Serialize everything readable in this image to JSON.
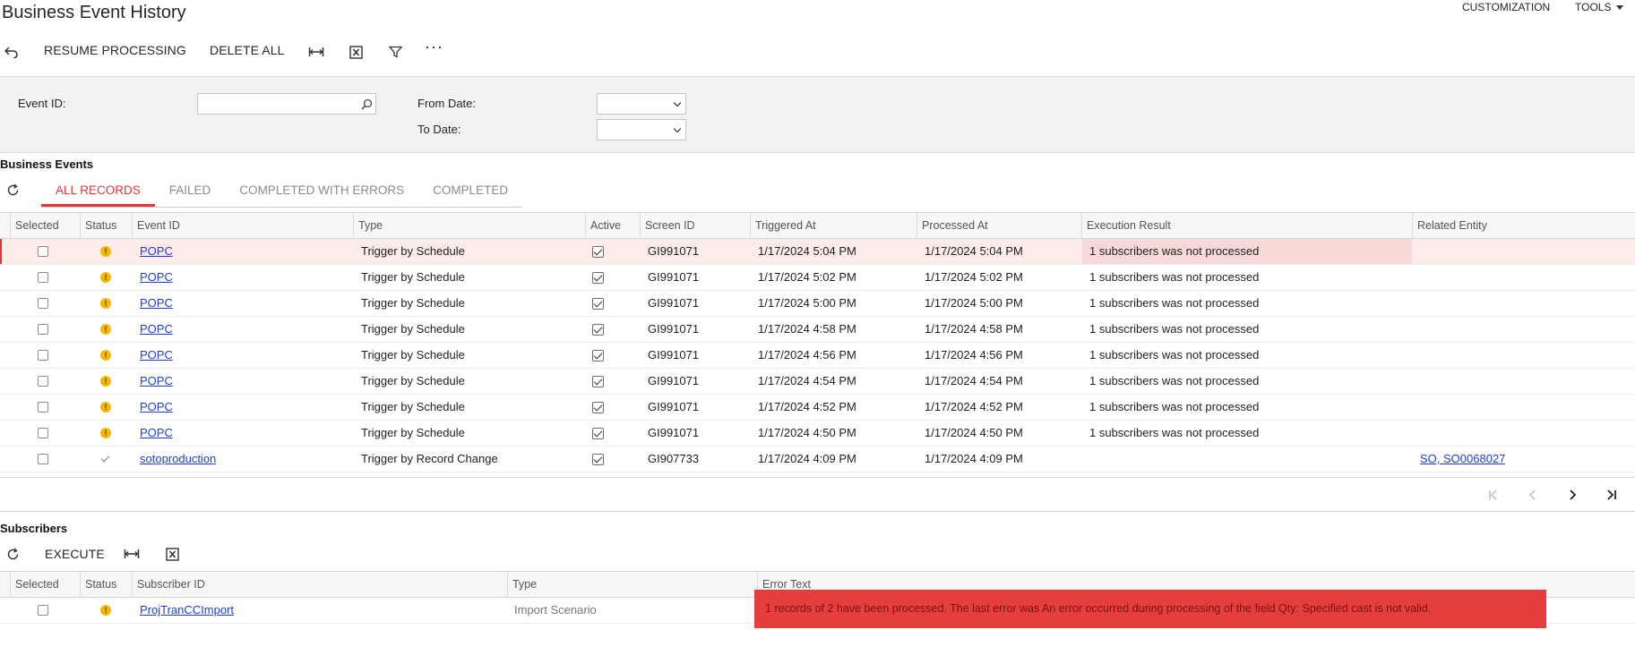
{
  "header": {
    "title": "Business Event History",
    "menu_customization": "CUSTOMIZATION",
    "menu_tools": "TOOLS"
  },
  "toolbar": {
    "undo_icon": "undo-icon",
    "resume_label": "RESUME PROCESSING",
    "delete_all_label": "DELETE ALL",
    "fit_icon": "fit-columns-icon",
    "excel_icon": "excel-export-icon",
    "filter_icon": "filter-icon",
    "more_label": "···"
  },
  "filters": {
    "event_id_label": "Event ID:",
    "event_id_value": "",
    "from_date_label": "From Date:",
    "from_date_value": "",
    "to_date_label": "To Date:",
    "to_date_value": ""
  },
  "events": {
    "section_title": "Business Events",
    "tabs": [
      "ALL RECORDS",
      "FAILED",
      "COMPLETED WITH ERRORS",
      "COMPLETED"
    ],
    "active_tab": 0,
    "columns": [
      "Selected",
      "Status",
      "Event ID",
      "Type",
      "Active",
      "Screen ID",
      "Triggered At",
      "Processed At",
      "Execution Result",
      "Related Entity"
    ],
    "rows": [
      {
        "selected": false,
        "status": "warning",
        "event_id": "POPC",
        "type": "Trigger by Schedule",
        "active": true,
        "screen_id": "GI991071",
        "triggered_at": "1/17/2024 5:04 PM",
        "processed_at": "1/17/2024 5:04 PM",
        "result": "1 subscribers was not processed",
        "related": ""
      },
      {
        "selected": false,
        "status": "warning",
        "event_id": "POPC",
        "type": "Trigger by Schedule",
        "active": true,
        "screen_id": "GI991071",
        "triggered_at": "1/17/2024 5:02 PM",
        "processed_at": "1/17/2024 5:02 PM",
        "result": "1 subscribers was not processed",
        "related": ""
      },
      {
        "selected": false,
        "status": "warning",
        "event_id": "POPC",
        "type": "Trigger by Schedule",
        "active": true,
        "screen_id": "GI991071",
        "triggered_at": "1/17/2024 5:00 PM",
        "processed_at": "1/17/2024 5:00 PM",
        "result": "1 subscribers was not processed",
        "related": ""
      },
      {
        "selected": false,
        "status": "warning",
        "event_id": "POPC",
        "type": "Trigger by Schedule",
        "active": true,
        "screen_id": "GI991071",
        "triggered_at": "1/17/2024 4:58 PM",
        "processed_at": "1/17/2024 4:58 PM",
        "result": "1 subscribers was not processed",
        "related": ""
      },
      {
        "selected": false,
        "status": "warning",
        "event_id": "POPC",
        "type": "Trigger by Schedule",
        "active": true,
        "screen_id": "GI991071",
        "triggered_at": "1/17/2024 4:56 PM",
        "processed_at": "1/17/2024 4:56 PM",
        "result": "1 subscribers was not processed",
        "related": ""
      },
      {
        "selected": false,
        "status": "warning",
        "event_id": "POPC",
        "type": "Trigger by Schedule",
        "active": true,
        "screen_id": "GI991071",
        "triggered_at": "1/17/2024 4:54 PM",
        "processed_at": "1/17/2024 4:54 PM",
        "result": "1 subscribers was not processed",
        "related": ""
      },
      {
        "selected": false,
        "status": "warning",
        "event_id": "POPC",
        "type": "Trigger by Schedule",
        "active": true,
        "screen_id": "GI991071",
        "triggered_at": "1/17/2024 4:52 PM",
        "processed_at": "1/17/2024 4:52 PM",
        "result": "1 subscribers was not processed",
        "related": ""
      },
      {
        "selected": false,
        "status": "warning",
        "event_id": "POPC",
        "type": "Trigger by Schedule",
        "active": true,
        "screen_id": "GI991071",
        "triggered_at": "1/17/2024 4:50 PM",
        "processed_at": "1/17/2024 4:50 PM",
        "result": "1 subscribers was not processed",
        "related": ""
      },
      {
        "selected": false,
        "status": "ok",
        "event_id": "sotoproduction",
        "type": "Trigger by Record Change",
        "active": true,
        "screen_id": "GI907733",
        "triggered_at": "1/17/2024 4:09 PM",
        "processed_at": "1/17/2024 4:09 PM",
        "result": "",
        "related": "SO, SO0068027"
      }
    ]
  },
  "pager": {
    "first_icon": "first-page-icon",
    "prev_icon": "previous-page-icon",
    "next_icon": "next-page-icon",
    "last_icon": "last-page-icon"
  },
  "subscribers": {
    "section_title": "Subscribers",
    "execute_label": "EXECUTE",
    "columns": [
      "Selected",
      "Status",
      "Subscriber ID",
      "Type",
      "Error Text"
    ],
    "rows": [
      {
        "selected": false,
        "status": "warning",
        "subscriber_id": "ProjTranCCImport",
        "type": "Import Scenario",
        "error_text": "1 records of 2 have been processed. The last error was An error occurred during processing of the field Qty: Specified cast is not valid."
      }
    ]
  },
  "colors": {
    "accent": "#e2373a",
    "link": "#1f3fd6",
    "warning": "#f5b800",
    "error_highlight": "#e63d3d",
    "row_selected": "#fdecea"
  }
}
